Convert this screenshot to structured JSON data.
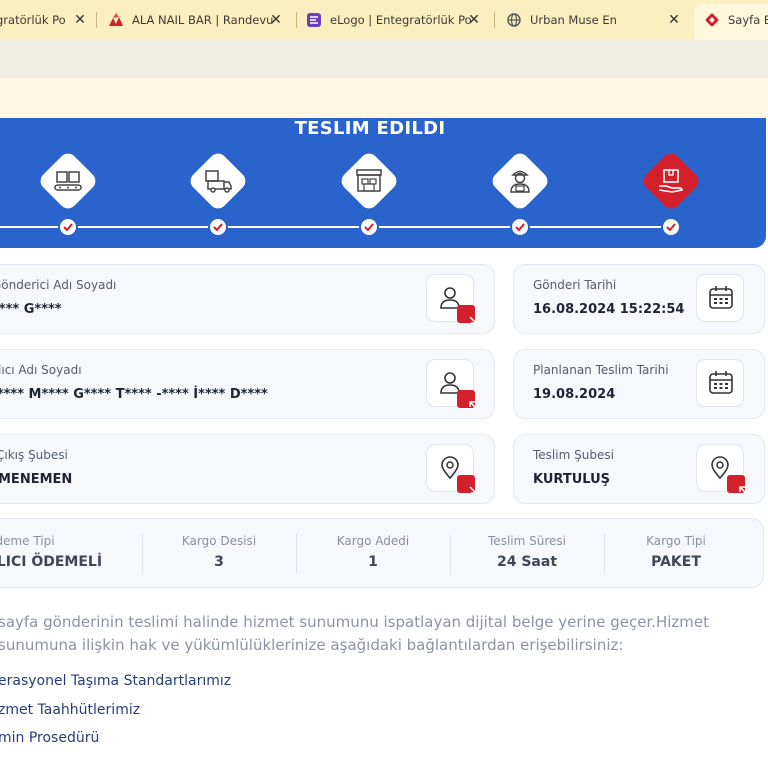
{
  "tabs": [
    {
      "title": "gratörlük Po",
      "icon": "page-icon"
    },
    {
      "title": "ALA NAIL BAR | Randevu",
      "icon": "ala-logo-icon"
    },
    {
      "title": "eLogo | Entegratörlük Po",
      "icon": "elogo-icon"
    },
    {
      "title": "Urban Muse En",
      "icon": "globe-icon"
    },
    {
      "title": "Sayfa Bu",
      "icon": "diamond-logo-icon"
    }
  ],
  "banner": {
    "title": "TESLIM EDILDI"
  },
  "steps": [
    {
      "icon": "boxes-conveyor-icon"
    },
    {
      "icon": "truck-icon"
    },
    {
      "icon": "warehouse-icon"
    },
    {
      "icon": "courier-icon"
    },
    {
      "icon": "delivered-box-icon"
    }
  ],
  "cards": {
    "sender": {
      "label": "Gönderici Adı Soyadı",
      "value": "**** G****"
    },
    "send_date": {
      "label": "Gönderi Tarihi",
      "value": "16.08.2024 15:22:54"
    },
    "receiver": {
      "label": "lıcı Adı Soyadı",
      "value": "J**** M**** G**** T**** -**** İ**** D****"
    },
    "planned_date": {
      "label": "Planlanan Teslim Tarihi",
      "value": "19.08.2024"
    },
    "origin_branch": {
      "label": "Çıkış Şubesi",
      "value": "MENEMEN"
    },
    "delivery_branch": {
      "label": "Teslim Şubesi",
      "value": "KURTULUŞ"
    }
  },
  "summary": [
    {
      "label": "Ödeme Tipi",
      "value": "ALICI ÖDEMELİ"
    },
    {
      "label": "Kargo Desisi",
      "value": "3"
    },
    {
      "label": "Kargo Adedi",
      "value": "1"
    },
    {
      "label": "Teslim Süresi",
      "value": "24 Saat"
    },
    {
      "label": "Kargo Tipi",
      "value": "PAKET"
    }
  ],
  "description": "sayfa gönderinin teslimi halinde hizmet sunumunu ispatlayan dijital belge yerine geçer.Hizmet sunumuna ilişkin hak ve yükümlülüklerinize aşağıdaki bağlantılardan erişebilirsiniz:",
  "links": [
    "erasyonel Taşıma Standartlarımız",
    "zmet Taahhütlerimiz",
    "min Prosedürü"
  ],
  "colors": {
    "brand_blue": "#2a63cc",
    "accent_red": "#d3202a",
    "tabbar": "#fbefbf"
  }
}
